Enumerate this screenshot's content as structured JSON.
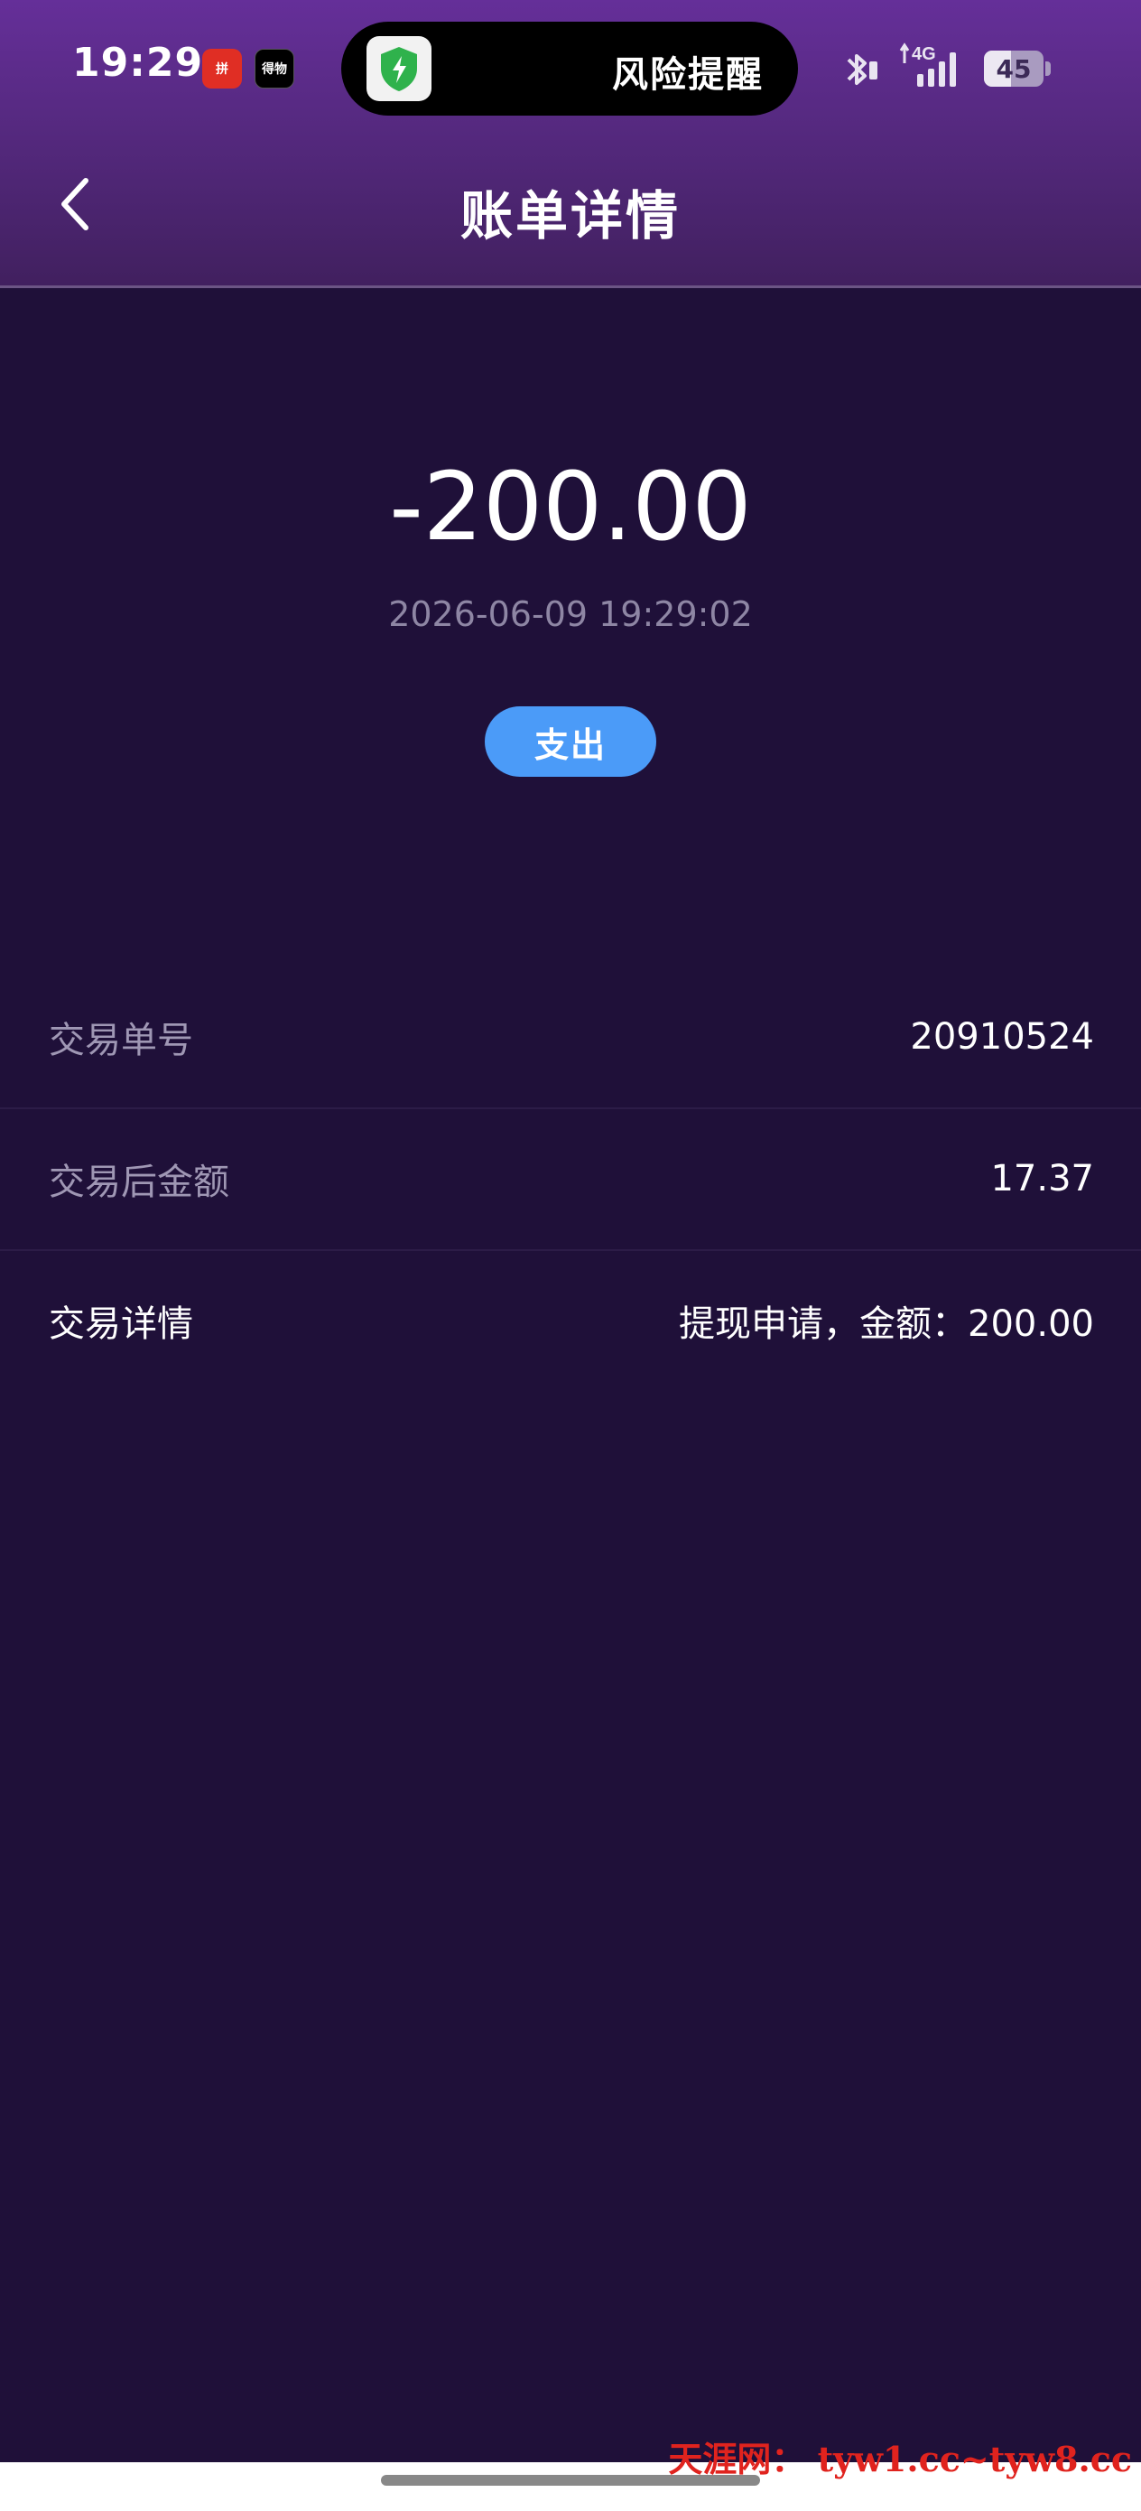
{
  "status_bar": {
    "time": "19:29",
    "notification_apps": [
      {
        "name": "pinduoduo-app-icon",
        "label": "拼"
      },
      {
        "name": "dewu-app-icon",
        "label": "得物"
      }
    ],
    "pill_text": "风险提醒",
    "network": "4G",
    "battery": "45",
    "battery_fraction": 0.45
  },
  "nav": {
    "title": "账单详情"
  },
  "summary": {
    "amount": "-200.00",
    "datetime": "2026-06-09 19:29:02",
    "type_label": "支出"
  },
  "details": [
    {
      "label": "交易单号",
      "value": "20910524"
    },
    {
      "label": "交易后金额",
      "value": "17.37"
    },
    {
      "label": "交易详情",
      "value": "提现申请，金额：200.00"
    }
  ],
  "watermark": "天涯网： tyw1.cc~tyw8.cc",
  "colors": {
    "background": "#1f1039",
    "header_top": "#652f99",
    "badge": "#4b9bf8",
    "muted_text": "#9f97b4",
    "watermark": "#e0231e"
  }
}
